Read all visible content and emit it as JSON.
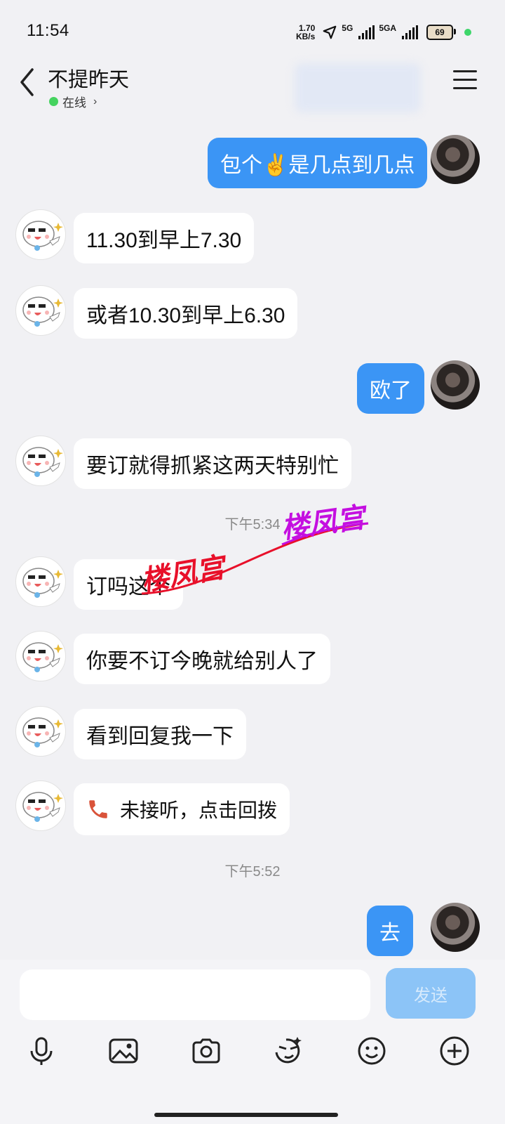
{
  "status_bar": {
    "time": "11:54",
    "net_speed_value": "1.70",
    "net_speed_unit": "KB/s",
    "signal1": "5G",
    "signal2": "5GA",
    "battery": "69"
  },
  "header": {
    "contact_name": "不提昨天",
    "status": "在线"
  },
  "messages": [
    {
      "id": "m1",
      "dir": "out",
      "text": "包个✌️是几点到几点"
    },
    {
      "id": "m2",
      "dir": "in",
      "text": "11.30到早上7.30"
    },
    {
      "id": "m3",
      "dir": "in",
      "text": "或者10.30到早上6.30"
    },
    {
      "id": "m4",
      "dir": "out",
      "text": "欧了"
    },
    {
      "id": "m5",
      "dir": "in",
      "text": "要订就得抓紧这两天特别忙"
    },
    {
      "id": "t1",
      "type": "time",
      "text": "下午5:34"
    },
    {
      "id": "m6",
      "dir": "in",
      "text": "订吗这个"
    },
    {
      "id": "m7",
      "dir": "in",
      "text": "你要不订今晚就给别人了"
    },
    {
      "id": "m8",
      "dir": "in",
      "text": "看到回复我一下"
    },
    {
      "id": "m9",
      "dir": "in",
      "type": "call",
      "text": "未接听，点击回拨"
    },
    {
      "id": "t2",
      "type": "time",
      "text": "下午5:52"
    },
    {
      "id": "m10",
      "dir": "out",
      "text": "去"
    }
  ],
  "watermark": {
    "text": "楼凤宫"
  },
  "input": {
    "placeholder": "",
    "send_label": "发送"
  },
  "toolbar": [
    "mic-icon",
    "image-icon",
    "camera-icon",
    "sticker-icon",
    "emoji-icon",
    "plus-icon"
  ],
  "colors": {
    "out_bubble": "#3b95f5",
    "in_bubble": "#ffffff",
    "call_text": "#d9533a",
    "background": "#f1f1f4",
    "online": "#45d35f"
  }
}
